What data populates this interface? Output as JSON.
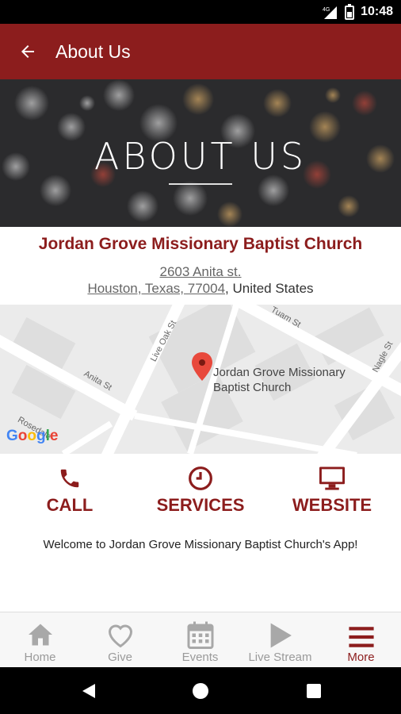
{
  "status": {
    "time": "10:48",
    "network": "4G"
  },
  "app_bar": {
    "title": "About Us"
  },
  "hero": {
    "title": "ABOUT US"
  },
  "church": {
    "name": "Jordan Grove Missionary Baptist Church",
    "address_line1": "2603 Anita st.",
    "address_line2": "Houston, Texas, 77004",
    "country": ", United States"
  },
  "map": {
    "marker_label_line1": "Jordan Grove Missionary",
    "marker_label_line2": "Baptist Church",
    "streets": [
      "Tuam St",
      "Live Oak St",
      "Anita St",
      "Nagle St",
      "Rosedale"
    ],
    "logo": "Google"
  },
  "actions": [
    {
      "label": "CALL",
      "icon": "phone-icon"
    },
    {
      "label": "SERVICES",
      "icon": "clock-icon"
    },
    {
      "label": "WEBSITE",
      "icon": "monitor-icon"
    }
  ],
  "welcome": "Welcome to Jordan Grove Missionary Baptist Church's App!",
  "bottom_nav": [
    {
      "label": "Home",
      "icon": "home-icon",
      "active": false
    },
    {
      "label": "Give",
      "icon": "heart-icon",
      "active": false
    },
    {
      "label": "Events",
      "icon": "calendar-icon",
      "active": false
    },
    {
      "label": "Live Stream",
      "icon": "play-icon",
      "active": false
    },
    {
      "label": "More",
      "icon": "menu-icon",
      "active": true
    }
  ],
  "colors": {
    "brand": "#8c1d1d",
    "inactive": "#9a9a9a"
  }
}
